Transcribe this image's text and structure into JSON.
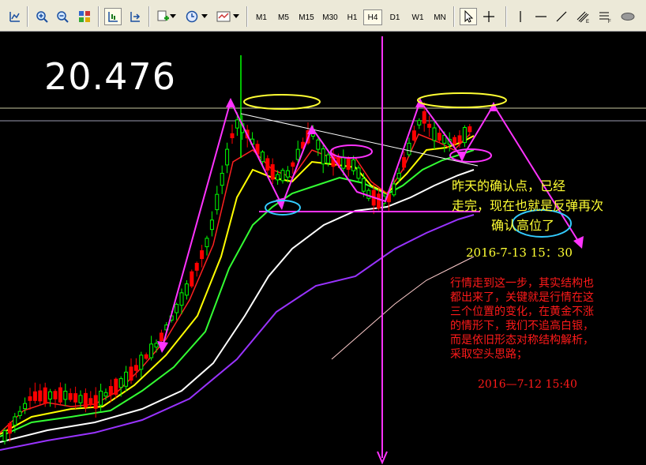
{
  "toolbar": {
    "timeframes": [
      "M1",
      "M5",
      "M15",
      "M30",
      "H1",
      "H4",
      "D1",
      "W1",
      "MN"
    ],
    "active_timeframe": "H4"
  },
  "chart": {
    "price_label": "20.476",
    "colors": {
      "bull": "#00ff00",
      "bear": "#ff0000",
      "ma_red": "#ff2020",
      "ma_yellow": "#ffff00",
      "ma_green": "#33ff33",
      "ma_white": "#ffffff",
      "ma_purple": "#9933ff",
      "ma_pink": "#ffcccc",
      "annotation_magenta": "#ff33ff",
      "annotation_yellow": "#ffff33",
      "annotation_cyan": "#33ccff"
    }
  },
  "annotations": {
    "yellow_note_line1": "昨天的确认点，已经",
    "yellow_note_line2": "走完，现在也就是反弹再次",
    "yellow_note_line3": "确认高位了",
    "yellow_timestamp": "2016-7-13  15：30",
    "red_note_line1": "行情走到这一步，其实结构也",
    "red_note_line2": "都出来了，关键就是行情在这",
    "red_note_line3": "三个位置的变化，在黄金不涨",
    "red_note_line4": "的情形下，我们不追高白银，",
    "red_note_line5": "而是依旧形态对称结构解析，",
    "red_note_line6": "采取空头思路；",
    "red_timestamp": "2016—7-12  15:40"
  }
}
